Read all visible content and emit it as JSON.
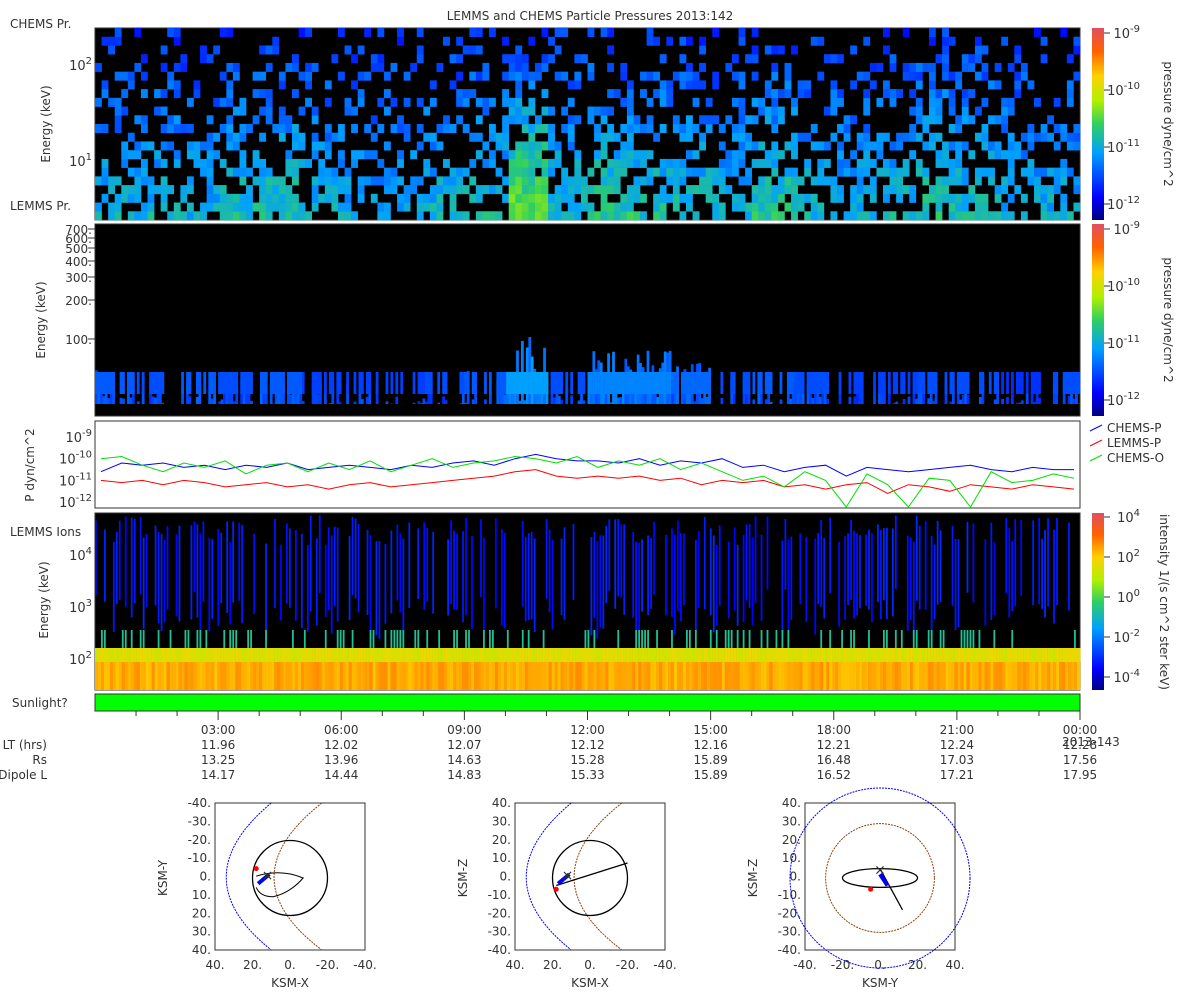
{
  "title": "LEMMS and CHEMS Particle Pressures  2013:142",
  "colors": {
    "chems_p": "#0000ff",
    "lemms_p": "#ff0000",
    "chems_o": "#00e000",
    "sunlight": "#00ff00"
  },
  "panels": {
    "chems": {
      "label": "CHEMS Pr.",
      "ylabel": "Energy (keV)",
      "yticks": [
        "10",
        "10"
      ],
      "yexp": [
        "2",
        "1"
      ],
      "cbar_label": "pressure dyne/cm^2",
      "cbar_ticks": [
        "10",
        "10",
        "10",
        "10"
      ],
      "cbar_exp": [
        "-9",
        "-10",
        "-11",
        "-12"
      ]
    },
    "lemms": {
      "label": "LEMMS Pr.",
      "ylabel": "Energy (keV)",
      "yticks": [
        "700.",
        "600.",
        "500.",
        "400.",
        "300.",
        "200.",
        "100."
      ],
      "cbar_label": "pressure dyne/cm^2",
      "cbar_ticks": [
        "10",
        "10",
        "10",
        "10"
      ],
      "cbar_exp": [
        "-9",
        "-10",
        "-11",
        "-12"
      ]
    },
    "pressure": {
      "ylabel": "P dyn/cm^2",
      "yticks": [
        "10",
        "10",
        "10",
        "10"
      ],
      "yexp": [
        "-9",
        "-10",
        "-11",
        "-12"
      ],
      "legend": [
        "CHEMS-P",
        "LEMMS-P",
        "CHEMS-O"
      ]
    },
    "ions": {
      "label": "LEMMS Ions",
      "ylabel": "Energy (keV)",
      "yticks": [
        "10",
        "10",
        "10"
      ],
      "yexp": [
        "4",
        "3",
        "2"
      ],
      "cbar_label": "intensity 1/(s cm^2 ster keV)",
      "cbar_ticks": [
        "10",
        "10",
        "10",
        "10",
        "10"
      ],
      "cbar_exp": [
        "4",
        "2",
        "0",
        "-2",
        "-4"
      ]
    },
    "sunlight": {
      "label": "Sunlight?",
      "value": "yes"
    }
  },
  "time_axis": {
    "times": [
      "03:00",
      "06:00",
      "09:00",
      "12:00",
      "15:00",
      "18:00",
      "21:00",
      "00:00"
    ],
    "end_date": "2013-143",
    "rows": [
      {
        "label": "LT (hrs)",
        "values": [
          "11.96",
          "12.02",
          "12.07",
          "12.12",
          "12.16",
          "12.21",
          "12.24",
          "12.28"
        ]
      },
      {
        "label": "Rs",
        "values": [
          "13.25",
          "13.96",
          "14.63",
          "15.28",
          "15.89",
          "16.48",
          "17.03",
          "17.56"
        ]
      },
      {
        "label": "Dipole L",
        "values": [
          "14.17",
          "14.44",
          "14.83",
          "15.33",
          "15.89",
          "16.52",
          "17.21",
          "17.95"
        ]
      }
    ]
  },
  "orbits": [
    {
      "xlabel": "KSM-X",
      "ylabel": "KSM-Y",
      "xticks": [
        "40.",
        "20.",
        "0.",
        "-20.",
        "-40."
      ],
      "yticks": [
        "-40.",
        "-30.",
        "-20.",
        "-10.",
        "0.",
        "10.",
        "20.",
        "30.",
        "40."
      ]
    },
    {
      "xlabel": "KSM-X",
      "ylabel": "KSM-Z",
      "xticks": [
        "40.",
        "20.",
        "0.",
        "-20.",
        "-40."
      ],
      "yticks": [
        "40.",
        "30.",
        "20.",
        "10.",
        "0.",
        "-10.",
        "-20.",
        "-30.",
        "-40."
      ]
    },
    {
      "xlabel": "KSM-Y",
      "ylabel": "KSM-Z",
      "xticks": [
        "-40.",
        "-20.",
        "0.",
        "20.",
        "40."
      ],
      "yticks": [
        "40.",
        "30.",
        "20.",
        "10.",
        "0.",
        "-10.",
        "-20.",
        "-30.",
        "-40."
      ]
    }
  ],
  "chart_data": [
    {
      "type": "heatmap",
      "title": "CHEMS Pr.",
      "x_range_hours": [
        0,
        24
      ],
      "ylim_keV": [
        2.5,
        245
      ],
      "yscale": "log",
      "zlim": [
        1e-12,
        1e-09
      ],
      "activity_by_hour": [
        0.5,
        0.55,
        0.5,
        0.6,
        0.65,
        0.5,
        0.45,
        0.5,
        0.55,
        0.6,
        0.95,
        0.6,
        0.7,
        0.65,
        0.6,
        0.55,
        0.7,
        0.55,
        0.5,
        0.55,
        0.65,
        0.6,
        0.5,
        0.5
      ]
    },
    {
      "type": "heatmap",
      "title": "LEMMS Pr.",
      "x_range_hours": [
        0,
        24
      ],
      "ylim_keV": [
        26,
        750
      ],
      "yscale": "log",
      "zlim": [
        1e-12,
        1e-09
      ],
      "activity_by_hour": [
        0.5,
        0.4,
        0.5,
        0.4,
        0.5,
        0.3,
        0.3,
        0.3,
        0.4,
        0.5,
        1.0,
        0.4,
        0.8,
        0.8,
        0.6,
        0.4,
        0.5,
        0.4,
        0.3,
        0.3,
        0.4,
        0.4,
        0.2,
        0.4
      ]
    },
    {
      "type": "line",
      "ylabel": "P dyn/cm^2",
      "yscale": "log",
      "ylim": [
        1e-12,
        3e-09
      ],
      "x_hours_step": 0.5,
      "series": [
        {
          "name": "CHEMS-P",
          "log10_values": [
            -10.6,
            -10.2,
            -10.3,
            -10.2,
            -10.4,
            -10.3,
            -10.5,
            -10.3,
            -10.4,
            -10.2,
            -10.5,
            -10.4,
            -10.3,
            -10.4,
            -10.5,
            -10.3,
            -10.4,
            -10.2,
            -10.1,
            -10.3,
            -10.0,
            -9.8,
            -10.0,
            -10.1,
            -10.1,
            -10.2,
            -10.0,
            -10.3,
            -10.1,
            -10.2,
            -10.0,
            -10.4,
            -10.3,
            -10.6,
            -10.4,
            -10.3,
            -10.8,
            -10.4,
            -10.5,
            -10.6,
            -10.5,
            -10.4,
            -10.3,
            -10.5,
            -10.6,
            -10.4,
            -10.5,
            -10.5
          ]
        },
        {
          "name": "LEMMS-P",
          "log10_values": [
            -11.0,
            -11.1,
            -11.0,
            -11.2,
            -11.0,
            -11.1,
            -11.3,
            -11.2,
            -11.1,
            -11.3,
            -11.2,
            -11.4,
            -11.2,
            -11.1,
            -11.3,
            -11.2,
            -11.1,
            -11.0,
            -10.9,
            -10.8,
            -10.6,
            -10.5,
            -10.8,
            -10.9,
            -10.8,
            -10.9,
            -10.8,
            -11.0,
            -10.9,
            -11.2,
            -11.0,
            -11.1,
            -11.0,
            -11.3,
            -11.2,
            -11.4,
            -11.2,
            -11.1,
            -11.6,
            -11.2,
            -11.3,
            -11.5,
            -11.2,
            -11.3,
            -11.4,
            -11.2,
            -11.3,
            -11.4
          ]
        },
        {
          "name": "CHEMS-O",
          "log10_values": [
            -10.0,
            -9.9,
            -10.3,
            -10.6,
            -10.2,
            -10.4,
            -10.1,
            -10.7,
            -10.3,
            -10.2,
            -10.6,
            -10.2,
            -10.5,
            -10.1,
            -10.6,
            -10.3,
            -10.0,
            -10.4,
            -10.2,
            -10.1,
            -9.9,
            -10.0,
            -10.2,
            -9.9,
            -10.4,
            -10.1,
            -10.3,
            -10.0,
            -10.5,
            -10.2,
            -10.6,
            -11.0,
            -10.8,
            -11.3,
            -10.6,
            -11.0,
            -12.5,
            -10.7,
            -11.2,
            -12.4,
            -10.9,
            -11.0,
            -12.3,
            -10.6,
            -11.1,
            -11.0,
            -10.7,
            -10.9
          ]
        }
      ]
    },
    {
      "type": "heatmap",
      "title": "LEMMS Ions",
      "x_range_hours": [
        0,
        24
      ],
      "ylim_keV": [
        25,
        63000
      ],
      "yscale": "log",
      "zlim": [
        1e-05,
        10000.0
      ]
    }
  ]
}
